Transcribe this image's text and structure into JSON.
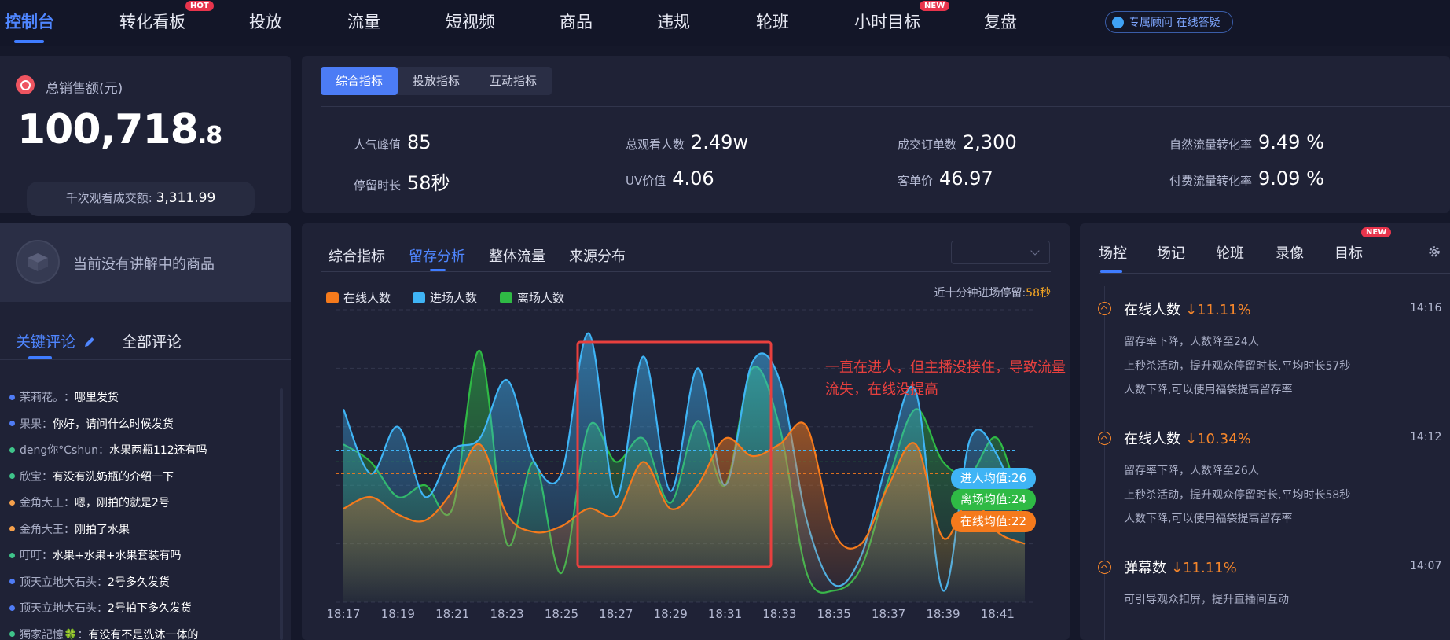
{
  "nav": {
    "items": [
      {
        "label": "控制台",
        "badge": ""
      },
      {
        "label": "转化看板",
        "badge": "HOT"
      },
      {
        "label": "投放",
        "badge": ""
      },
      {
        "label": "流量",
        "badge": ""
      },
      {
        "label": "短视频",
        "badge": ""
      },
      {
        "label": "商品",
        "badge": ""
      },
      {
        "label": "违规",
        "badge": ""
      },
      {
        "label": "轮班",
        "badge": ""
      },
      {
        "label": "小时目标",
        "badge": "NEW"
      },
      {
        "label": "复盘",
        "badge": ""
      }
    ],
    "active_index": 0,
    "advisor": {
      "icon": "chat-bubble-icon",
      "label": "专属顾问 在线答疑"
    }
  },
  "sales": {
    "icon": "money-circle-icon",
    "label": "总销售额(元)",
    "value_int": "100,718",
    "value_dec": ".8",
    "kview_label": "千次观看成交额:",
    "kview_value": "3,311.99"
  },
  "indicators": {
    "tabs": [
      "综合指标",
      "投放指标",
      "互动指标"
    ],
    "active_tab": 0,
    "metrics": [
      {
        "label": "人气峰值",
        "value": "85"
      },
      {
        "label": "总观看人数",
        "value": "2.49w"
      },
      {
        "label": "成交订单数",
        "value": "2,300"
      },
      {
        "label": "自然流量转化率",
        "value": "9.49 %"
      },
      {
        "label": "停留时长",
        "value": "58秒"
      },
      {
        "label": "UV价值",
        "value": "4.06"
      },
      {
        "label": "客单价",
        "value": "46.97"
      },
      {
        "label": "付费流量转化率",
        "value": "9.09 %"
      }
    ]
  },
  "product": {
    "icon": "empty-box-icon",
    "text": "当前没有讲解中的商品"
  },
  "comments": {
    "tabs": [
      "关键评论",
      "全部评论"
    ],
    "edit_icon": "pencil-icon",
    "items": [
      {
        "user": "茉莉花。",
        "text": "哪里发货",
        "color": "#4f7cf6"
      },
      {
        "user": "果果",
        "text": "你好，请问什么时候发货",
        "color": "#4f7cf6"
      },
      {
        "user": "deng你°Cshun",
        "text": "水果两瓶112还有吗",
        "color": "#3fc48a"
      },
      {
        "user": "欣宝",
        "text": "有没有洗奶瓶的介绍一下",
        "color": "#3fc48a"
      },
      {
        "user": "金角大王",
        "text": "嗯，刚拍的就是2号",
        "color": "#f5a04b"
      },
      {
        "user": "金角大王",
        "text": "刚拍了水果",
        "color": "#f5a04b"
      },
      {
        "user": "叮叮",
        "text": "水果+水果+水果套装有吗",
        "color": "#3fc48a"
      },
      {
        "user": "顶天立地大石头",
        "text": "2号多久发货",
        "color": "#4f7cf6"
      },
      {
        "user": "顶天立地大石头",
        "text": "2号拍下多久发货",
        "color": "#4f7cf6"
      },
      {
        "user": "獨家記憶🍀",
        "text": "有没有不是洗沐一体的",
        "color": "#3fc48a"
      }
    ]
  },
  "chart_panel": {
    "tabs": [
      "综合指标",
      "留存分析",
      "整体流量",
      "来源分布"
    ],
    "active_tab": 1,
    "stay_label": "近十分钟进场停留:",
    "stay_value": "58秒",
    "annotation_line1": "一直在进人，但主播没接住，导致流量",
    "annotation_line2": "流失，在线没提高",
    "avg_enter_label": "进人均值:26",
    "avg_leave_label": "离场均值:24",
    "avg_online_label": "在线均值:22"
  },
  "chart_data": {
    "type": "line",
    "x": [
      "18:17",
      "18:18",
      "18:19",
      "18:20",
      "18:21",
      "18:22",
      "18:23",
      "18:24",
      "18:25",
      "18:26",
      "18:27",
      "18:28",
      "18:29",
      "18:30",
      "18:31",
      "18:32",
      "18:33",
      "18:34",
      "18:35",
      "18:36",
      "18:37",
      "18:38",
      "18:39",
      "18:40",
      "18:41",
      "18:42"
    ],
    "tick_labels": [
      "18:17",
      "18:19",
      "18:21",
      "18:23",
      "18:25",
      "18:27",
      "18:29",
      "18:31",
      "18:33",
      "18:35",
      "18:37",
      "18:39",
      "18:41"
    ],
    "ylim": [
      0,
      50
    ],
    "series": [
      {
        "name": "在线人数",
        "color": "#f57a1c",
        "values": [
          16,
          18,
          15,
          14,
          19,
          27,
          15,
          12,
          13,
          16,
          15,
          24,
          16,
          20,
          28,
          25,
          27,
          30,
          12,
          10,
          20,
          27,
          11,
          18,
          12,
          10
        ]
      },
      {
        "name": "进场人数",
        "color": "#3fb4f5",
        "values": [
          33,
          22,
          30,
          18,
          26,
          28,
          38,
          24,
          22,
          46,
          18,
          42,
          19,
          40,
          20,
          41,
          38,
          14,
          3,
          8,
          25,
          36,
          2,
          28,
          25,
          12
        ]
      },
      {
        "name": "离场人数",
        "color": "#2fba45",
        "values": [
          27,
          24,
          18,
          20,
          16,
          43,
          10,
          24,
          5,
          30,
          24,
          28,
          17,
          31,
          20,
          40,
          30,
          5,
          2,
          6,
          21,
          33,
          24,
          22,
          28,
          13
        ]
      }
    ],
    "averages": {
      "进人均值": 26,
      "离场均值": 24,
      "在线均值": 22
    },
    "grid": true,
    "legend": "top-left"
  },
  "right_panel": {
    "tabs": [
      "场控",
      "场记",
      "轮班",
      "录像",
      "目标"
    ],
    "active_tab": 0,
    "badge": "NEW",
    "settings_icon": "gear-icon",
    "events": [
      {
        "title": "在线人数",
        "pct": "↓11.11%",
        "time": "14:16",
        "lines": [
          "留存率下降，人数降至24人",
          "上秒杀活动，提升观众停留时长,平均时长57秒",
          "人数下降,可以使用福袋提高留存率"
        ]
      },
      {
        "title": "在线人数",
        "pct": "↓10.34%",
        "time": "14:12",
        "lines": [
          "留存率下降，人数降至26人",
          "上秒杀活动，提升观众停留时长,平均时长58秒",
          "人数下降,可以使用福袋提高留存率"
        ]
      },
      {
        "title": "弹幕数",
        "pct": "↓11.11%",
        "time": "14:07",
        "lines": [
          "可引导观众扣屏，提升直播间互动"
        ]
      }
    ]
  }
}
